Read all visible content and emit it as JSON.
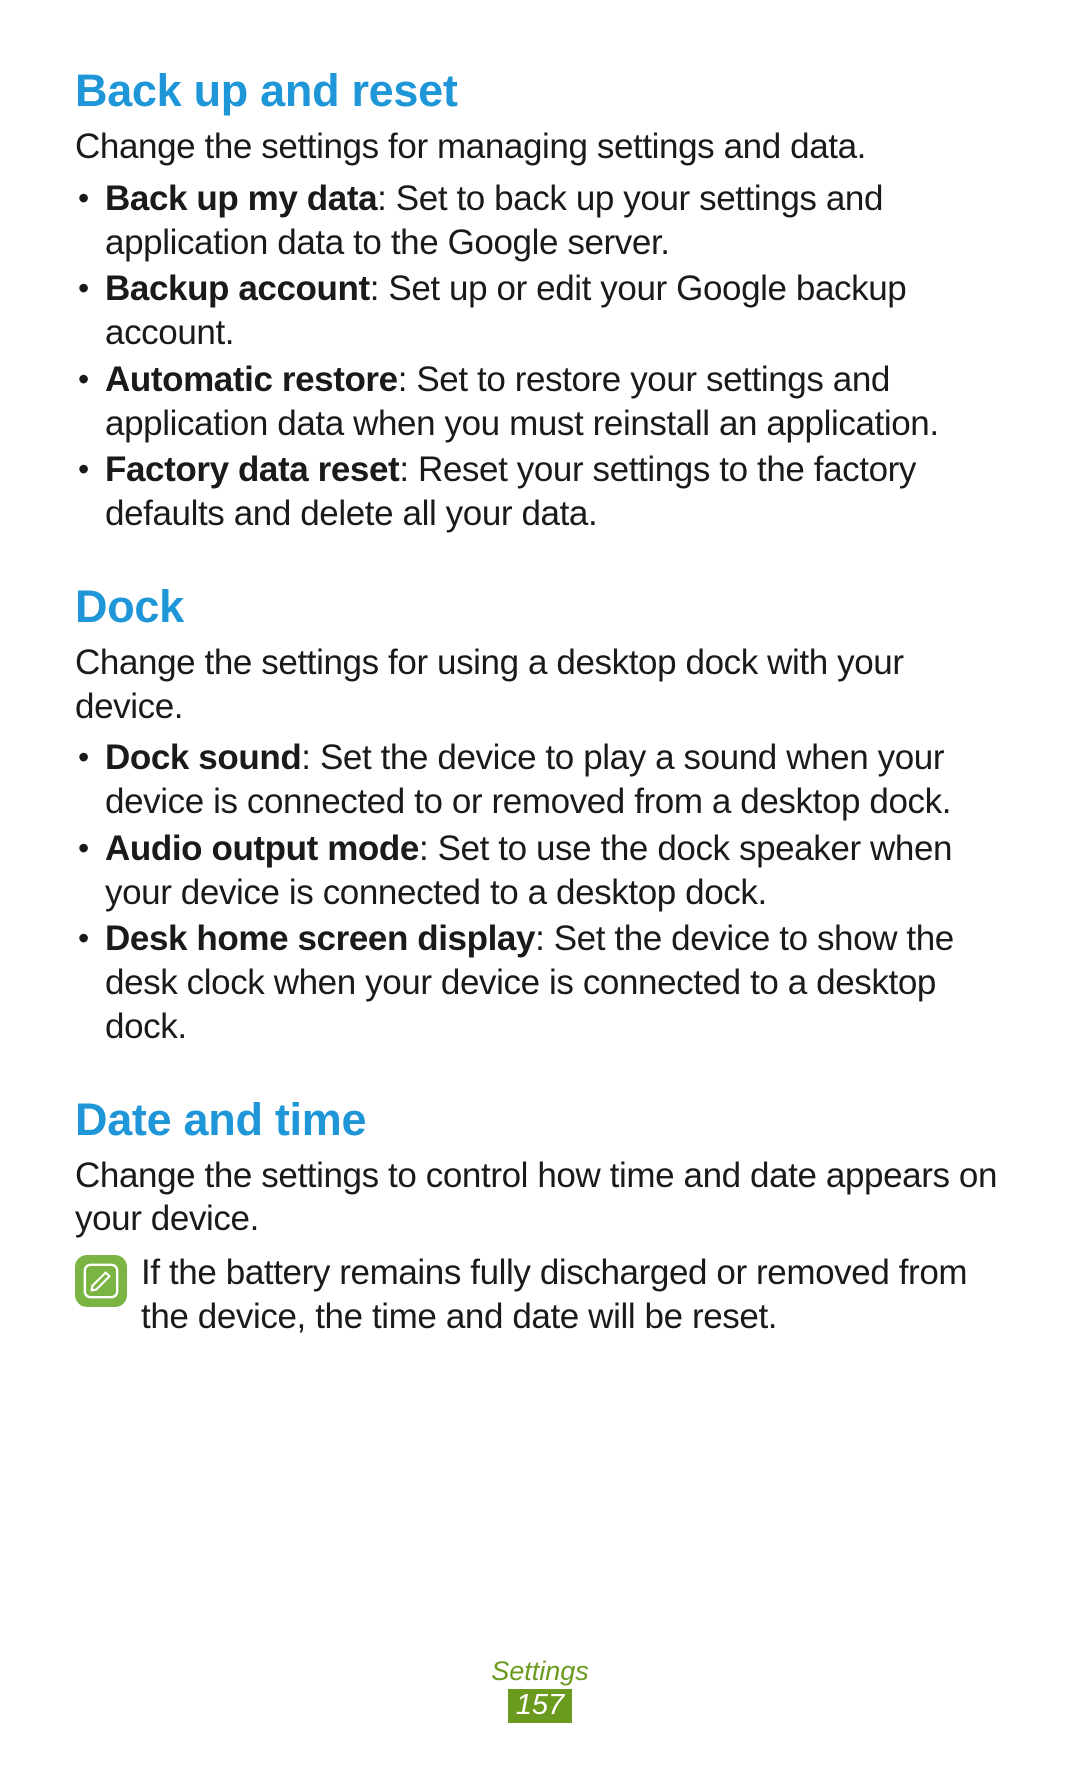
{
  "sections": {
    "backup": {
      "heading": "Back up and reset",
      "desc": "Change the settings for managing settings and data.",
      "items": [
        {
          "label": "Back up my data",
          "text": ": Set to back up your settings and application data to the Google server."
        },
        {
          "label": "Backup account",
          "text": ": Set up or edit your Google backup account."
        },
        {
          "label": "Automatic restore",
          "text": ": Set to restore your settings and application data when you must reinstall an application."
        },
        {
          "label": "Factory data reset",
          "text": ": Reset your settings to the factory defaults and delete all your data."
        }
      ]
    },
    "dock": {
      "heading": "Dock",
      "desc": "Change the settings for using a desktop dock with your device.",
      "items": [
        {
          "label": "Dock sound",
          "text": ": Set the device to play a sound when your device is connected to or removed from a desktop dock."
        },
        {
          "label": "Audio output mode",
          "text": ": Set to use the dock speaker when your device is connected to a desktop dock."
        },
        {
          "label": "Desk home screen display",
          "text": ": Set the device to show the desk clock when your device is connected to a desktop dock."
        }
      ]
    },
    "datetime": {
      "heading": "Date and time",
      "desc": "Change the settings to control how time and date appears on your device.",
      "note": "If the battery remains fully discharged or removed from the device, the time and date will be reset."
    }
  },
  "footer": {
    "label": "Settings",
    "page": "157"
  }
}
